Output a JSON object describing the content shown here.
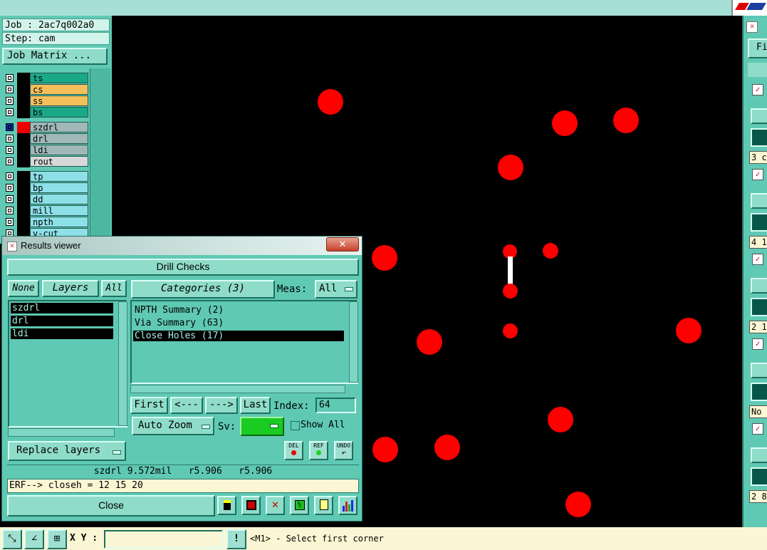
{
  "info": {
    "job": "Job : 2ac7q002a0",
    "step": "Step: cam",
    "job_matrix": "Job Matrix ..."
  },
  "layers": [
    {
      "name": "ts",
      "color": "#1aa888"
    },
    {
      "name": "cs",
      "color": "#f4c05c"
    },
    {
      "name": "ss",
      "color": "#f4c05c"
    },
    {
      "name": "bs",
      "color": "#1aa888"
    },
    {
      "name": "szdrl",
      "color": "#a0b8b8"
    },
    {
      "name": "drl",
      "color": "#a0b8b8"
    },
    {
      "name": "ldi",
      "color": "#a0b8b8"
    },
    {
      "name": "rout",
      "color": "#d8d8d8"
    },
    {
      "name": "tp",
      "color": "#8ee0e8"
    },
    {
      "name": "bp",
      "color": "#8ee0e8"
    },
    {
      "name": "dd",
      "color": "#8ee0e8"
    },
    {
      "name": "mill",
      "color": "#8ee0e8"
    },
    {
      "name": "npth",
      "color": "#8ee0e8"
    },
    {
      "name": "v-cut",
      "color": "#8ee0e8"
    }
  ],
  "results_viewer": {
    "title": "Results viewer",
    "header": "Drill Checks",
    "none_label": "None",
    "layers_label": "Layers",
    "all_label": "All",
    "categories_label": "Categories (3)",
    "meas_label": "Meas:",
    "meas_value": "All",
    "layer_list": [
      "szdrl",
      "drl",
      "ldi"
    ],
    "category_list": [
      "NPTH Summary (2)",
      "Via Summary (63)",
      "Close Holes (17)"
    ],
    "first_label": "First",
    "prev_label": "<---",
    "next_label": "--->",
    "last_label": "Last",
    "index_label": "Index:",
    "index_value": "64",
    "auto_zoom_label": "Auto Zoom",
    "sv_label": "Sv:",
    "show_all_label": "Show All",
    "replace_layers_label": "Replace layers",
    "del_label": "DEL",
    "ref_label": "REF",
    "undo_label": "UNDO",
    "measure_text": "szdrl 9.572mil   r5.906   r5.906",
    "erf_text": "ERF--> closeh = 12 15 20",
    "close_label": "Close"
  },
  "status": {
    "xy_label": "X Y :",
    "hint": "<M1> - Select first corner",
    "excl": "!"
  },
  "right_panel": {
    "top_label": "Fi",
    "values": [
      "3 c",
      "4 1",
      "2 1",
      "No",
      "2 8"
    ]
  }
}
